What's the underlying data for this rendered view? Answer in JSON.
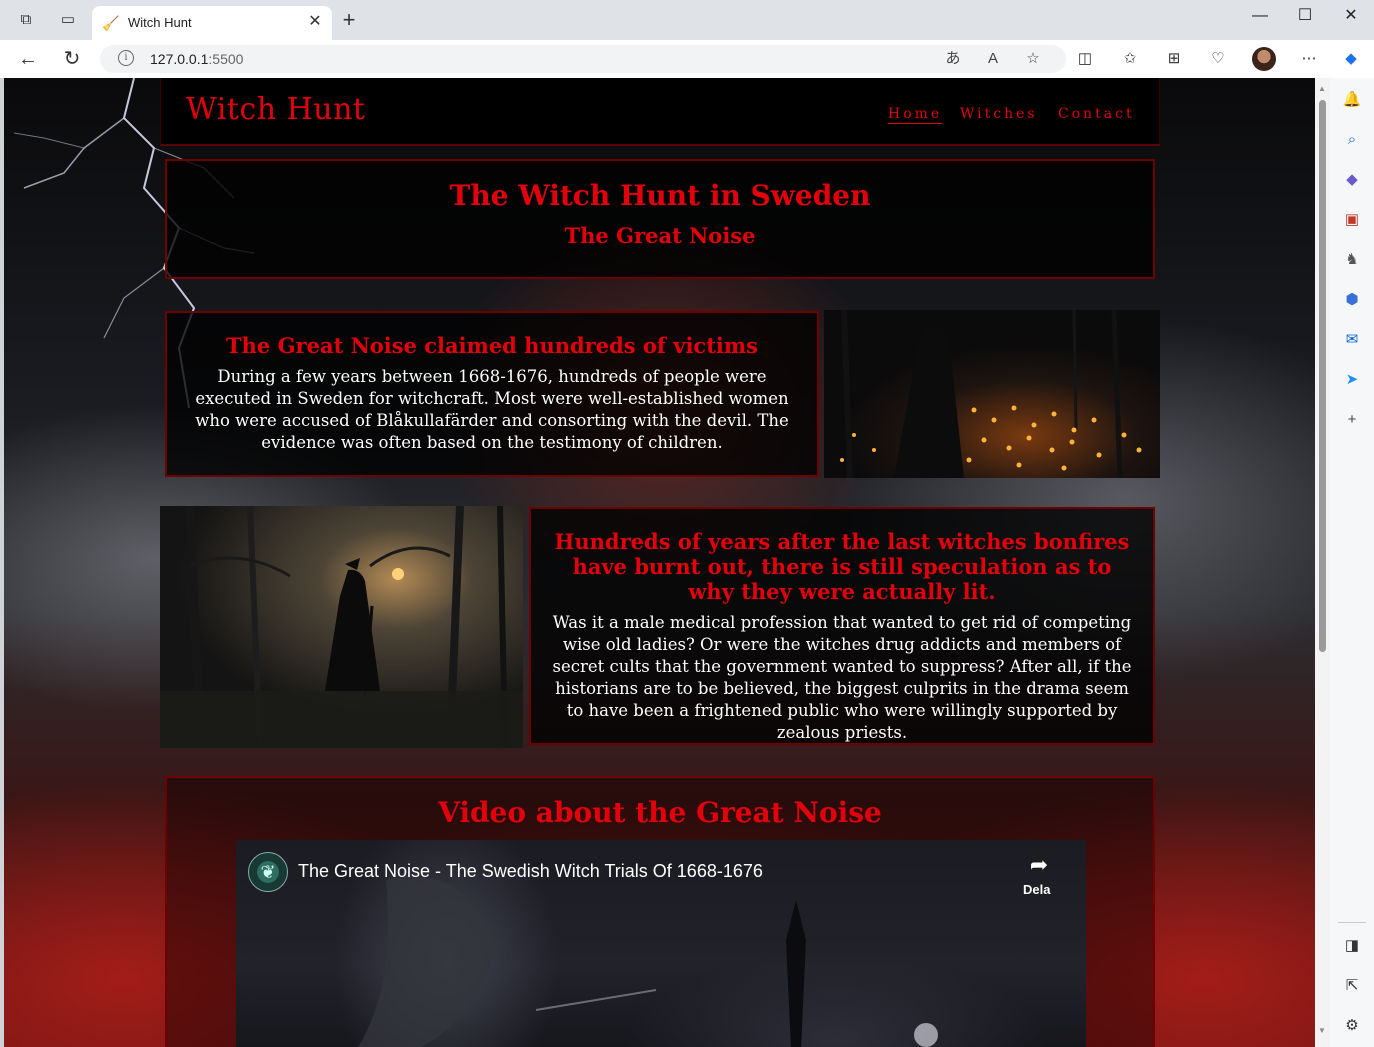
{
  "browser": {
    "tab_title": "Witch Hunt",
    "url_host": "127.0.0.1",
    "url_port": ":5500",
    "icons": [
      "workspaces-icon",
      "tab-actions-icon",
      "back-icon",
      "refresh-icon",
      "info-icon",
      "translate-icon",
      "read-aloud-icon",
      "favorite-star-icon",
      "split-screen-icon",
      "favorites-icon",
      "collections-icon",
      "browser-essentials-icon",
      "profile-avatar",
      "more-icon",
      "copilot-icon"
    ]
  },
  "site": {
    "logo": "Witch Hunt",
    "nav": [
      {
        "label": "Home",
        "active": true
      },
      {
        "label": "Witches",
        "active": false
      },
      {
        "label": "Contact",
        "active": false
      }
    ],
    "hero": {
      "title": "The Witch Hunt in Sweden",
      "subtitle": "The Great Noise"
    },
    "card1": {
      "title": "The Great Noise claimed hundreds of victims",
      "text": "During a few years between 1668-1676, hundreds of people were executed in Sweden for witchcraft. Most were well-established women who were accused of Blåkullafärder and consorting with the devil. The evidence was often based on the testimony of children."
    },
    "card2": {
      "title": "Hundreds of years after the last witches bonfires have burnt out, there is still speculation as to why they were actually lit.",
      "text": "Was it a male medical profession that wanted to get rid of competing wise old ladies? Or were the witches drug addicts and members of secret cults that the government wanted to suppress? After all, if the historians are to be believed, the biggest culprits in the drama seem to have been a frightened public who were willingly supported by zealous priests."
    },
    "video": {
      "heading": "Video about the Great Noise",
      "title": "The Great Noise - The Swedish Witch Trials Of 1668-1676",
      "share_label": "Dela"
    }
  },
  "colors": {
    "accent_red": "#e3000c",
    "border_red": "#6e0000",
    "panel_black": "#000000"
  }
}
